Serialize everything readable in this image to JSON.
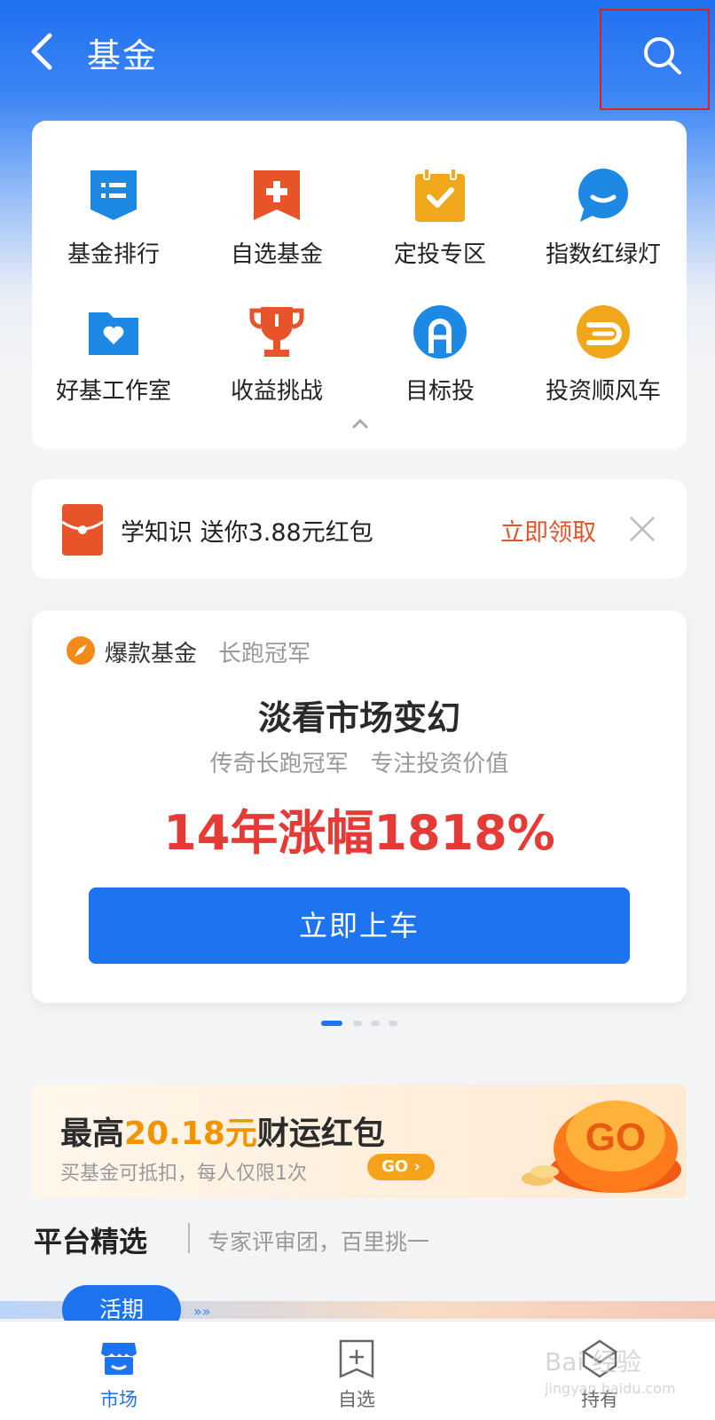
{
  "header": {
    "title": "基金",
    "back_icon": "chevron-left-icon",
    "search_icon": "search-icon"
  },
  "quick_menu": {
    "items": [
      {
        "label": "基金排行",
        "icon": "ranking-icon",
        "color": "#1e88e5"
      },
      {
        "label": "自选基金",
        "icon": "bookmark-add-icon",
        "color": "#e8542a"
      },
      {
        "label": "定投专区",
        "icon": "calendar-check-icon",
        "color": "#f1a71c"
      },
      {
        "label": "指数红绿灯",
        "icon": "chat-bubble-icon",
        "color": "#1e88e5"
      },
      {
        "label": "好基工作室",
        "icon": "folder-heart-icon",
        "color": "#1e88e5"
      },
      {
        "label": "收益挑战",
        "icon": "trophy-icon",
        "color": "#e8542a"
      },
      {
        "label": "目标投",
        "icon": "target-icon",
        "color": "#1e88e5"
      },
      {
        "label": "投资顺风车",
        "icon": "car-icon",
        "color": "#f1a71c"
      }
    ],
    "collapse_icon": "chevron-up-icon"
  },
  "promo": {
    "text": "学知识 送你3.88元红包",
    "action": "立即领取",
    "icon": "red-envelope-icon",
    "close_icon": "close-icon"
  },
  "hot_fund": {
    "tag": "爆款基金",
    "subtag": "长跑冠军",
    "title": "淡看市场变幻",
    "desc": "传奇长跑冠军   专注投资价值",
    "stat": "14年涨幅1818%",
    "button": "立即上车",
    "accent": "#e53a36",
    "brand": "#1e73ef"
  },
  "carousel": {
    "count": 4,
    "active": 0
  },
  "banner": {
    "title_prefix": "最高",
    "title_amount": "20.18元",
    "title_suffix": "财运红包",
    "subtitle": "买基金可抵扣，每人仅限1次",
    "go_pill": "GO ›",
    "go_art": "GO"
  },
  "section": {
    "title": "平台精选",
    "subtitle": "专家评审团，百里挑一"
  },
  "tab": {
    "label": "活期",
    "arrows": "»»"
  },
  "bottom_nav": {
    "items": [
      {
        "label": "市场",
        "icon": "store-icon",
        "active": true
      },
      {
        "label": "自选",
        "icon": "bookmark-add-icon",
        "active": false
      },
      {
        "label": "持有",
        "icon": "wallet-icon",
        "active": false
      }
    ]
  },
  "watermark": {
    "text": "Bai 经验",
    "url": "jingyan.baidu.com"
  }
}
